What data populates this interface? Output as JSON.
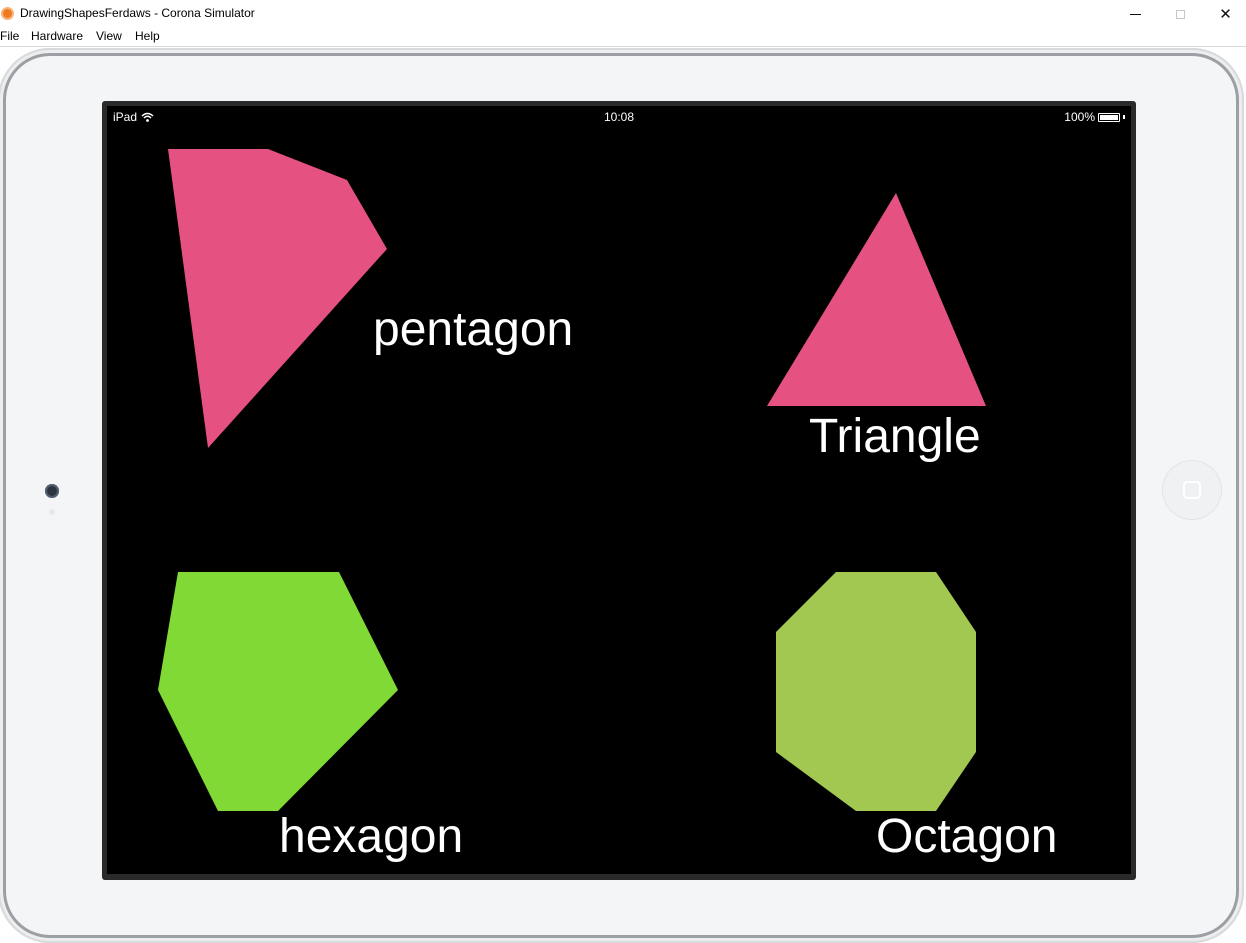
{
  "window": {
    "title": "DrawingShapesFerdaws - Corona Simulator",
    "icon": "corona-app-icon",
    "controls": {
      "minimize": "minimize-icon",
      "maximize": "maximize-icon",
      "close": "close-icon",
      "close_glyph": "✕"
    }
  },
  "menu": {
    "items": [
      "File",
      "Hardware",
      "View",
      "Help"
    ]
  },
  "status_bar": {
    "device": "iPad",
    "time": "10:08",
    "battery": "100%",
    "battery_level": 1.0,
    "wifi_icon": "wifi-icon",
    "battery_icon": "battery-icon"
  },
  "shapes": [
    {
      "label": "pentagon",
      "color": "#e55181"
    },
    {
      "label": "Triangle",
      "color": "#e55181"
    },
    {
      "label": "hexagon",
      "color": "#80d935"
    },
    {
      "label": "Octagon",
      "color": "#a2c851"
    }
  ],
  "colors": {
    "screen_background": "#000000",
    "label_color": "#ffffff",
    "device_frame": "#f4f5f7"
  }
}
